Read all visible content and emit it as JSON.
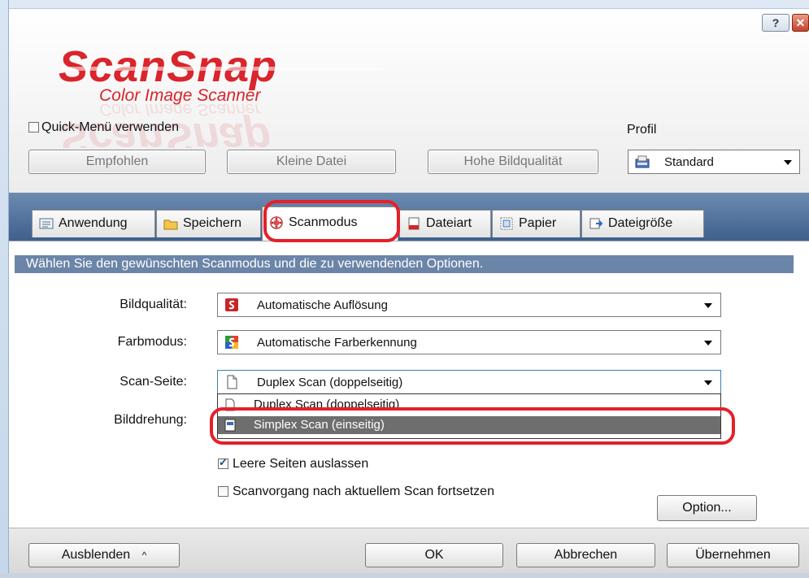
{
  "window": {
    "help_label": "?",
    "close_label": "✕"
  },
  "logo": {
    "brand": "ScanSnap",
    "subtitle": "Color Image Scanner",
    "brand_color": "#d9252b"
  },
  "header": {
    "quick_menu_label": "Quick-Menü verwenden",
    "quick_menu_checked": false,
    "presets": [
      "Empfohlen",
      "Kleine Datei",
      "Hohe Bildqualität"
    ],
    "profil_label": "Profil",
    "profil_value": "Standard"
  },
  "tabs": [
    {
      "label": "Anwendung",
      "icon": "application-icon"
    },
    {
      "label": "Speichern",
      "icon": "folder-icon"
    },
    {
      "label": "Scanmodus",
      "icon": "scanmode-icon",
      "active": true
    },
    {
      "label": "Dateiart",
      "icon": "filetype-icon"
    },
    {
      "label": "Papier",
      "icon": "paper-icon"
    },
    {
      "label": "Dateigröße",
      "icon": "filesize-icon"
    }
  ],
  "scanmode": {
    "hint": "Wählen Sie den gewünschten Scanmodus und die zu verwendenden Optionen.",
    "bildqualitaet_label": "Bildqualität:",
    "bildqualitaet_value": "Automatische Auflösung",
    "farbmodus_label": "Farbmodus:",
    "farbmodus_value": "Automatische Farberkennung",
    "scanseite_label": "Scan-Seite:",
    "scanseite_value": "Duplex Scan (doppelseitig)",
    "scanseite_options": [
      "Duplex Scan (doppelseitig)",
      "Simplex Scan (einseitig)"
    ],
    "scanseite_highlighted_option": "Simplex Scan (einseitig)",
    "bilddrehung_label": "Bilddrehung:",
    "leere_seiten_label": "Leere Seiten auslassen",
    "leere_seiten_checked": true,
    "fortsetzen_label": "Scanvorgang nach aktuellem Scan fortsetzen",
    "fortsetzen_checked": false,
    "option_button": "Option..."
  },
  "footer": {
    "ausblenden_label": "Ausblenden",
    "ok_label": "OK",
    "abbrechen_label": "Abbrechen",
    "uebernehmen_label": "Übernehmen"
  },
  "colors": {
    "tab_band": "#4f6f9a",
    "hint_bar": "#6b85a8",
    "highlight": "#e5202a",
    "selected_option": "#6e6e6e"
  }
}
